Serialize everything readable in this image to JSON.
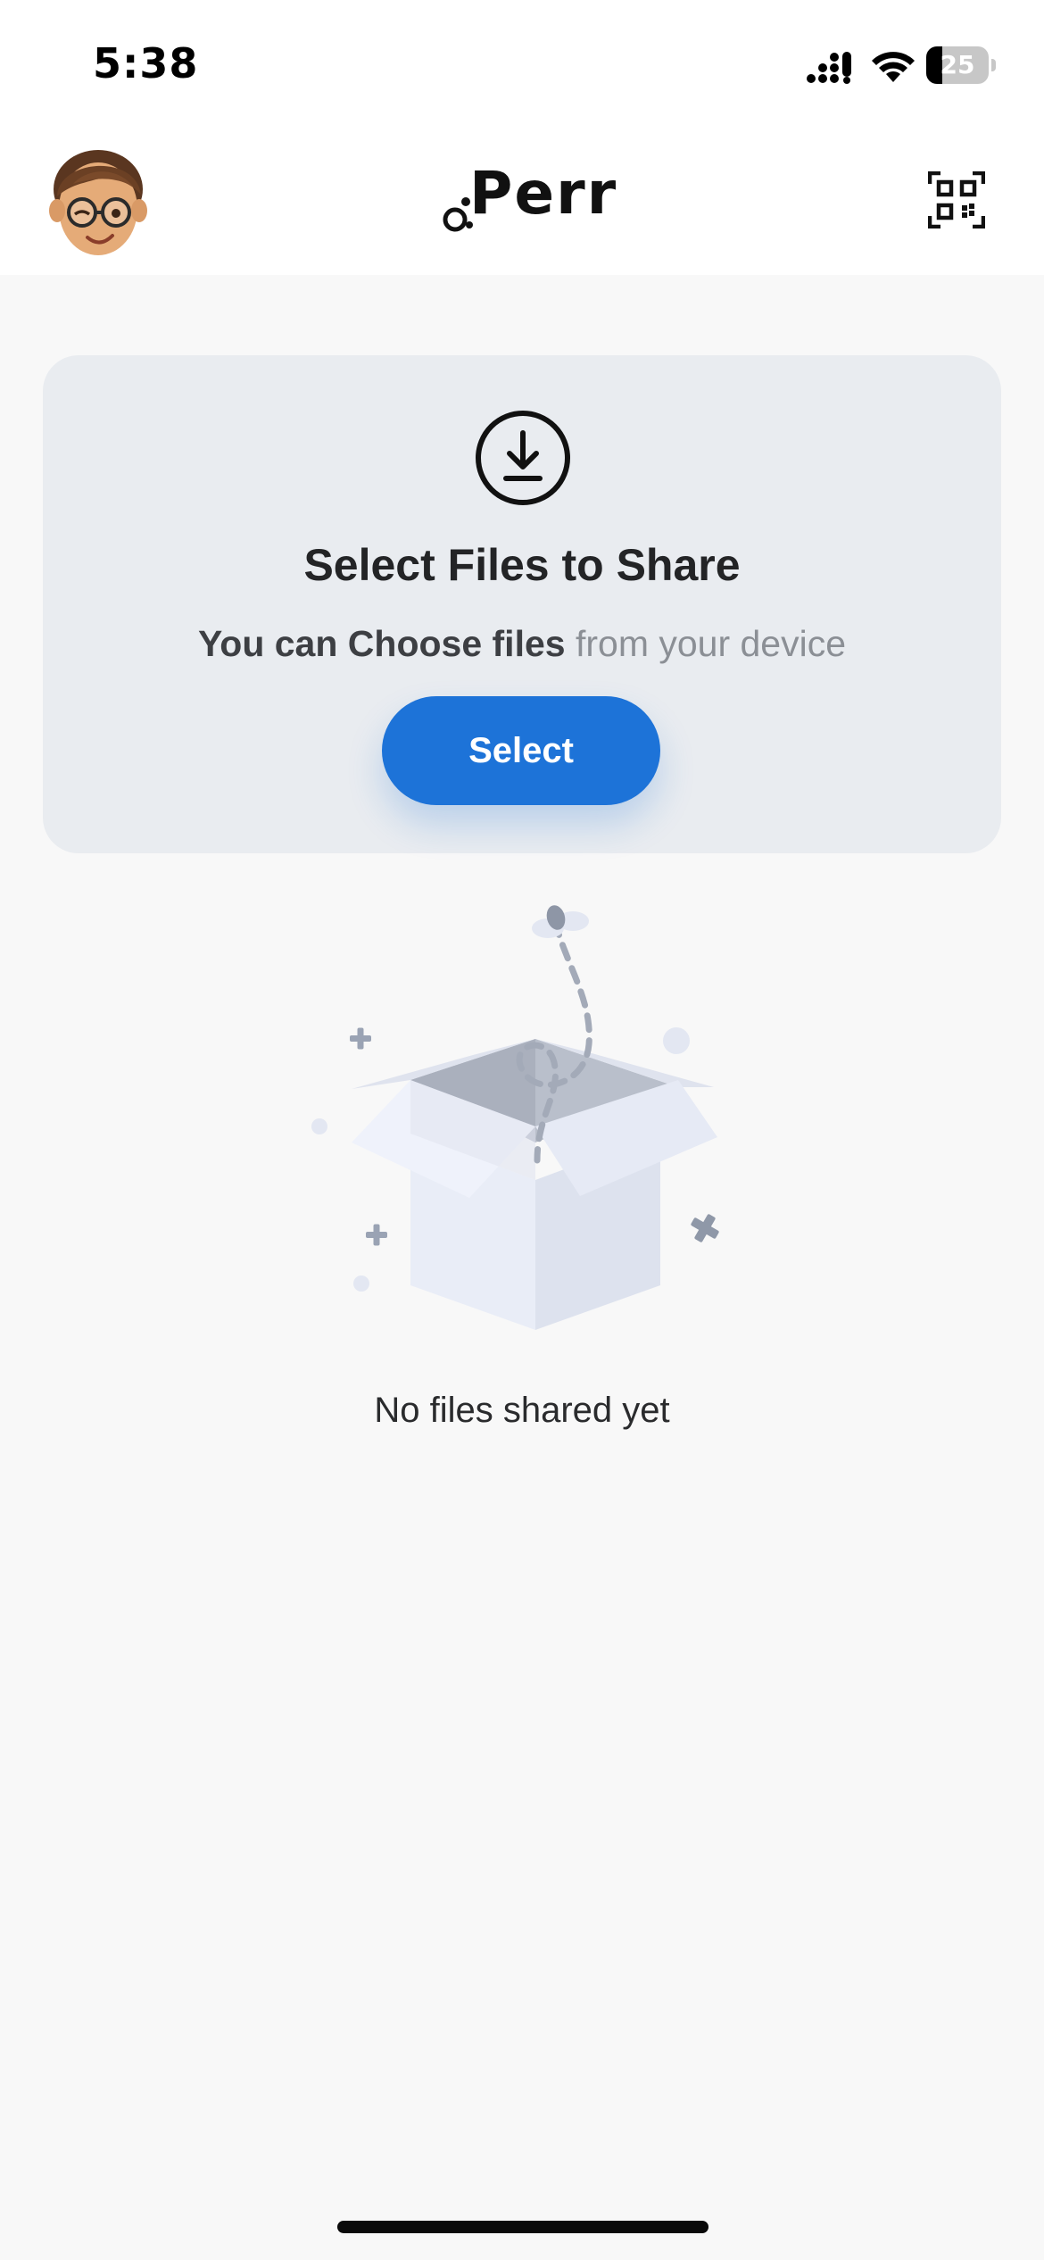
{
  "status_bar": {
    "time": "5:38",
    "battery_percent": 25,
    "battery_label": "25"
  },
  "header": {
    "logo_text": "Perr",
    "avatar_icon": "memoji-avatar",
    "qr_icon": "qr-scan-icon"
  },
  "upload_card": {
    "icon": "download-circle-icon",
    "title": "Select Files to Share",
    "subtitle_strong": "You can Choose files",
    "subtitle_light": " from your device",
    "select_label": "Select",
    "accent_color": "#1d73d8"
  },
  "empty_state": {
    "illustration": "empty-open-box-illustration",
    "message": "No files shared yet"
  }
}
